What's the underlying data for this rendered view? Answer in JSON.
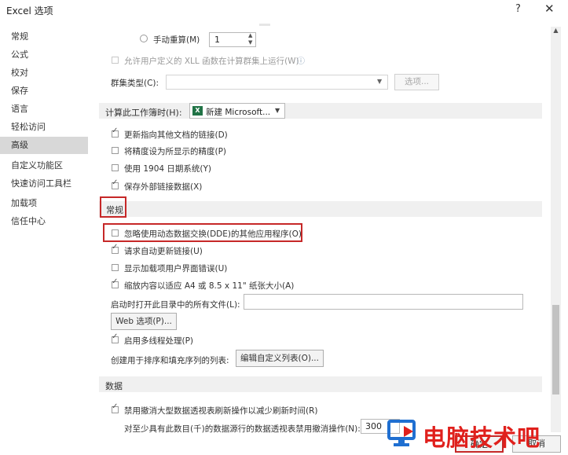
{
  "window": {
    "title": "Excel 选项",
    "help": "?",
    "close": "✕"
  },
  "nav": {
    "items": [
      {
        "label": "常规"
      },
      {
        "label": "公式"
      },
      {
        "label": "校对"
      },
      {
        "label": "保存"
      },
      {
        "label": "语言"
      },
      {
        "label": "轻松访问"
      },
      {
        "label": "高级"
      },
      {
        "label": "自定义功能区"
      },
      {
        "label": "快速访问工具栏"
      },
      {
        "label": "加载项"
      },
      {
        "label": "信任中心"
      }
    ],
    "active": "高级"
  },
  "formulas": {
    "manual_recalc_label": "手动重算(M)",
    "manual_recalc_value": "1",
    "xll_label": "允许用户定义的 XLL 函数在计算群集上运行(W)",
    "cluster_type_label": "群集类型(C):",
    "cluster_type_value": "",
    "options_button": "选项..."
  },
  "calc_workbook": {
    "header": "计算此工作簿时(H):",
    "workbook_value": "新建 Microsoft...",
    "items": [
      {
        "label": "更新指向其他文档的链接(D)",
        "checked": true
      },
      {
        "label": "将精度设为所显示的精度(P)",
        "checked": false
      },
      {
        "label": "使用 1904 日期系统(Y)",
        "checked": false
      },
      {
        "label": "保存外部链接数据(X)",
        "checked": true
      }
    ]
  },
  "general": {
    "header": "常规",
    "items": [
      {
        "label": "忽略使用动态数据交换(DDE)的其他应用程序(O)",
        "checked": false
      },
      {
        "label": "请求自动更新链接(U)",
        "checked": true
      },
      {
        "label": "显示加载项用户界面错误(U)",
        "checked": false
      },
      {
        "label": "缩放内容以适应 A4 或 8.5 x 11\" 纸张大小(A)",
        "checked": true
      }
    ],
    "startup_label": "启动时打开此目录中的所有文件(L):",
    "startup_value": "",
    "web_options_button": "Web 选项(P)...",
    "multithread_label": "启用多线程处理(P)",
    "multithread_checked": true,
    "custom_list_label": "创建用于排序和填充序列的列表:",
    "custom_list_button": "编辑自定义列表(O)..."
  },
  "data": {
    "header": "数据",
    "undo_large_label": "禁用撤消大型数据透视表刷新操作以减少刷新时间(R)",
    "undo_large_checked": true,
    "threshold_label": "对至少具有此数目(千)的数据源行的数据透视表禁用撤消操作(N):",
    "threshold_value": "300"
  },
  "footer": {
    "ok": "确定",
    "cancel": "取消"
  },
  "watermark": {
    "text": "电脑技术吧"
  },
  "colors": {
    "accent_green": "#217346",
    "highlight_red": "#c62828",
    "watermark_red": "#e0201c",
    "watermark_blue": "#1f6fd1"
  }
}
